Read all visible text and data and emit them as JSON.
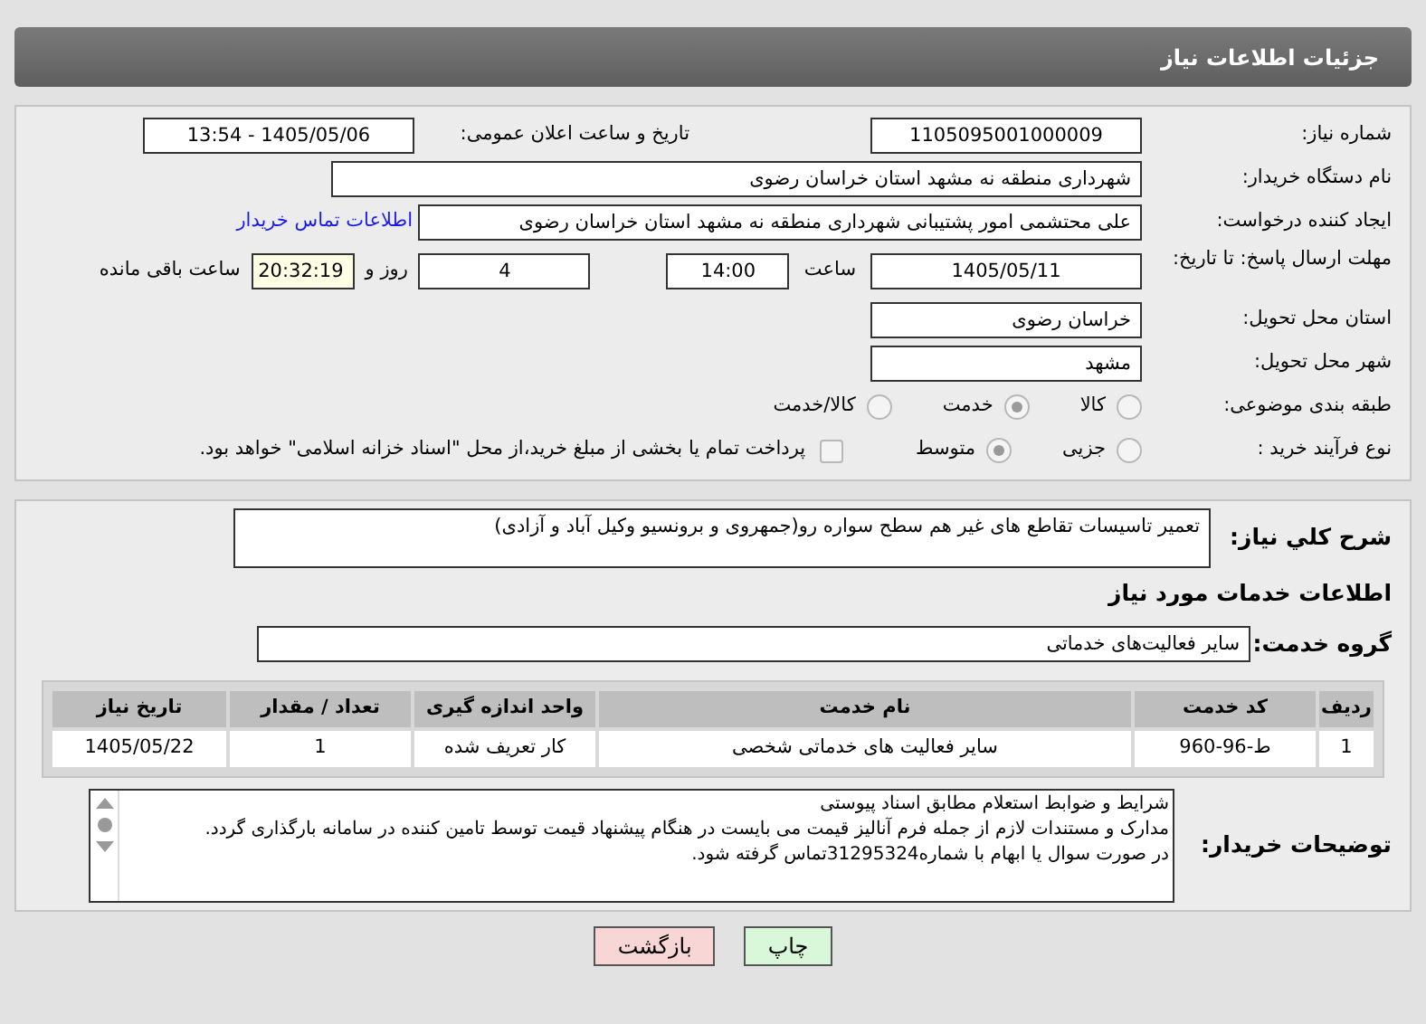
{
  "header": {
    "title": "جزئیات اطلاعات نیاز"
  },
  "need_number": {
    "label": "شماره نیاز:",
    "value": "1105095001000009"
  },
  "announce": {
    "label": "تاریخ و ساعت اعلان عمومی:",
    "value": "1405/05/06 - 13:54"
  },
  "buyer": {
    "label": "نام دستگاه خریدار:",
    "value": "شهرداری منطقه نه مشهد استان خراسان رضوی"
  },
  "requester": {
    "label": "ایجاد کننده درخواست:",
    "value": "علی محتشمی امور پشتیبانی شهرداری منطقه نه مشهد استان خراسان رضوی",
    "link": "اطلاعات تماس خریدار"
  },
  "deadline": {
    "label": "مهلت ارسال پاسخ: تا تاریخ:",
    "date": "1405/05/11",
    "time_label": "ساعت",
    "time": "14:00",
    "days": "4",
    "days_label": "روز و",
    "remaining": "20:32:19",
    "remaining_label": "ساعت باقی مانده"
  },
  "province": {
    "label": "استان محل تحویل:",
    "value": "خراسان رضوی"
  },
  "city": {
    "label": "شهر محل تحویل:",
    "value": "مشهد"
  },
  "category": {
    "label": "طبقه بندی موضوعی:",
    "options": [
      {
        "label": "کالا",
        "selected": false
      },
      {
        "label": "خدمت",
        "selected": true
      },
      {
        "label": "کالا/خدمت",
        "selected": false
      }
    ]
  },
  "process": {
    "label": "نوع فرآیند خرید :",
    "options": [
      {
        "label": "جزیی",
        "selected": false
      },
      {
        "label": "متوسط",
        "selected": true
      }
    ],
    "payment": {
      "label": "پرداخت تمام یا بخشی از مبلغ خرید،از محل \"اسناد خزانه اسلامی\" خواهد بود.",
      "checked": false
    }
  },
  "description": {
    "label": "شرح کلي نياز:",
    "value": "تعمیر تاسیسات تقاطع های غیر هم سطح سواره رو(جمهروی و برونسیو وکیل آباد و آزادی)"
  },
  "services_title": "اطلاعات خدمات مورد نیاز",
  "service_group": {
    "label": "گروه خدمت:",
    "value": "سایر فعالیت‌های خدماتی"
  },
  "table": {
    "columns": [
      "ردیف",
      "کد خدمت",
      "نام خدمت",
      "واحد اندازه گیری",
      "تعداد / مقدار",
      "تاریخ نیاز"
    ],
    "rows": [
      [
        "1",
        "ط-96-960",
        "سایر فعالیت های خدماتی شخصی",
        "کار تعریف شده",
        "1",
        "1405/05/22"
      ]
    ]
  },
  "buyer_notes": {
    "label": "توضیحات خریدار:",
    "lines": [
      "شرایط و ضوابط استعلام مطابق اسناد پیوستی",
      "مدارک و مستندات لازم از جمله فرم آنالیز قیمت می بایست در هنگام پیشنهاد قیمت توسط تامین کننده در سامانه بارگذاری گردد.",
      "در صورت سوال یا ابهام با شماره31295324تماس گرفته شود."
    ]
  },
  "buttons": [
    {
      "label": "چاپ",
      "kind": "print"
    },
    {
      "label": "بازگشت",
      "kind": "back"
    }
  ]
}
